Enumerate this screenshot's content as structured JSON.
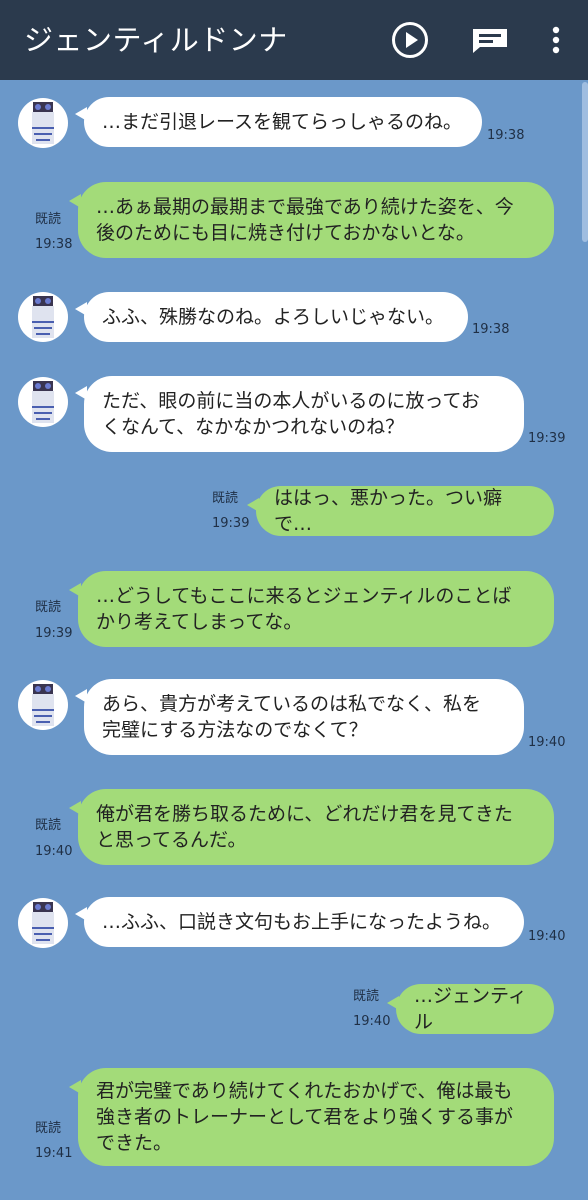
{
  "header": {
    "title": "ジェンティルドンナ",
    "play_icon": "play-icon",
    "chat_icon": "message-icon",
    "menu_icon": "more-vertical-icon"
  },
  "colors": {
    "header_bg": "#2b3a4d",
    "chat_bg": "#6b98c9",
    "incoming_bubble": "#ffffff",
    "outgoing_bubble": "#a3db79"
  },
  "read_label": "既読",
  "messages": [
    {
      "side": "in",
      "lines": [
        "…まだ引退レースを観てらっしゃるのね。"
      ],
      "time": "19:38"
    },
    {
      "side": "out",
      "lines": [
        "…あぁ最期の最期まで最強であり続けた姿を、今",
        "後のためにも目に焼き付けておかないとな。"
      ],
      "time": "19:38"
    },
    {
      "side": "in",
      "lines": [
        "ふふ、殊勝なのね。よろしいじゃない。"
      ],
      "time": "19:38"
    },
    {
      "side": "in",
      "lines": [
        "ただ、眼の前に当の本人がいるのに放ってお",
        "くなんて、なかなかつれないのね？"
      ],
      "time": "19:39"
    },
    {
      "side": "out",
      "lines": [
        "ははっ、悪かった。つい癖で…"
      ],
      "time": "19:39"
    },
    {
      "side": "out",
      "lines": [
        "…どうしてもここに来るとジェンティルのことば",
        "かり考えてしまってな。"
      ],
      "time": "19:39"
    },
    {
      "side": "in",
      "lines": [
        "あら、貴方が考えているのは私でなく、私を",
        "完璧にする方法なのでなくて？"
      ],
      "time": "19:40"
    },
    {
      "side": "out",
      "lines": [
        "俺が君を勝ち取るために、どれだけ君を見てきた",
        "と思ってるんだ。"
      ],
      "time": "19:40"
    },
    {
      "side": "in",
      "lines": [
        "…ふふ、口説き文句もお上手になったようね。"
      ],
      "time": "19:40"
    },
    {
      "side": "out",
      "lines": [
        "…ジェンティル"
      ],
      "time": "19:40"
    },
    {
      "side": "out",
      "lines": [
        "君が完璧であり続けてくれたおかげで、俺は最も",
        "強き者のトレーナーとして君をより強くする事が",
        "できた。"
      ],
      "time": "19:41"
    }
  ]
}
